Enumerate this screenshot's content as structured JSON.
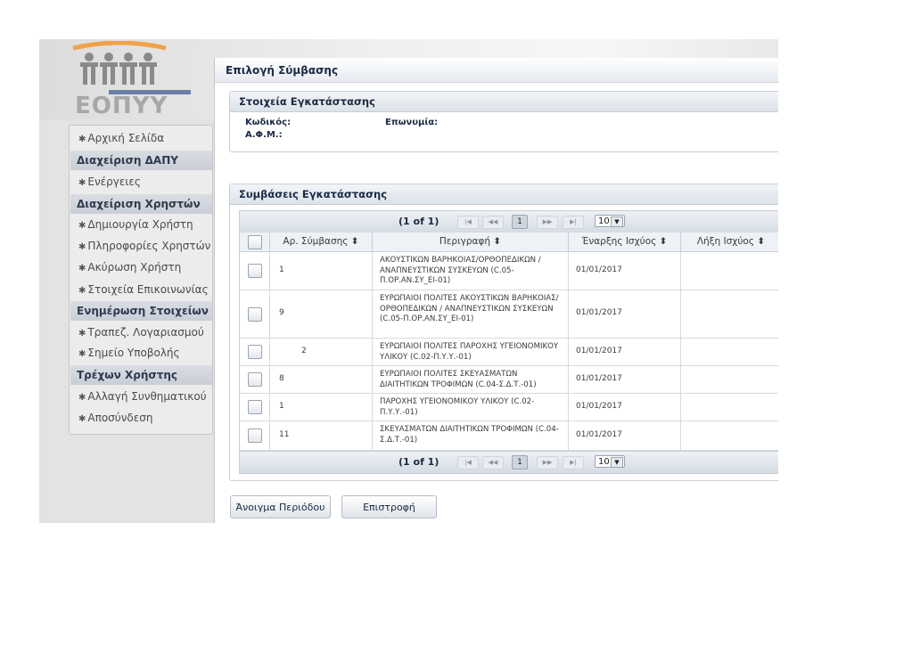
{
  "brand": {
    "logo_text": "ΕΟΠΥΥ"
  },
  "sidebar": {
    "items": [
      {
        "type": "link",
        "label": "Αρχική Σελίδα"
      },
      {
        "type": "header",
        "label": "Διαχείριση ΔΑΠΥ"
      },
      {
        "type": "link",
        "label": "Ενέργειες"
      },
      {
        "type": "header",
        "label": "Διαχείριση Χρηστών"
      },
      {
        "type": "link",
        "label": "Δημιουργία Χρήστη"
      },
      {
        "type": "link",
        "label": "Πληροφορίες Χρηστών"
      },
      {
        "type": "link",
        "label": "Ακύρωση Χρήστη"
      },
      {
        "type": "link",
        "label": "Στοιχεία Επικοινωνίας"
      },
      {
        "type": "header",
        "label": "Ενημέρωση Στοιχείων"
      },
      {
        "type": "link",
        "label": "Τραπεζ. Λογαριασμού"
      },
      {
        "type": "link",
        "label": "Σημείο Υποβολής"
      },
      {
        "type": "header",
        "label": "Τρέχων Χρήστης"
      },
      {
        "type": "link",
        "label": "Αλλαγή Συνθηματικού"
      },
      {
        "type": "link",
        "label": "Αποσύνδεση"
      }
    ]
  },
  "dialog": {
    "title": "Επιλογή Σύμβασης",
    "install_panel": {
      "title": "Στοιχεία Εγκατάστασης",
      "code_label": "Κωδικός:",
      "name_label": "Επωνυμία:",
      "afm_label": "Α.Φ.Μ.:"
    },
    "contracts_panel": {
      "title": "Συμβάσεις Εγκατάστασης",
      "pager": {
        "count": "(1 of 1)",
        "page": "1",
        "rows_per_page": "10"
      },
      "columns": [
        "Αρ. Σύμβασης",
        "Περιγραφή",
        "Έναρξης Ισχύος",
        "Λήξη Ισχύος"
      ],
      "sort_icon": "sort-both-icon",
      "rows": [
        {
          "number": "1",
          "description": "ΑΚΟΥΣΤΙΚΩΝ ΒΑΡΗΚΟΙΑΣ/ΟΡΘΟΠΕΔΙΚΩΝ / ΑΝΑΠΝΕΥΣΤΙΚΩΝ ΣΥΣΚΕΥΩΝ (C.05-Π.ΟΡ.ΑΝ.ΣΥ_ΕΙ-01)",
          "start": "01/01/2017",
          "end": ""
        },
        {
          "number": "9",
          "description": "ΕΥΡΩΠΑΙΟΙ ΠΟΛΙΤΕΣ ΑΚΟΥΣΤΙΚΩΝ ΒΑΡΗΚΟΙΑΣ/ΟΡΘΟΠΕΔΙΚΩΝ / ΑΝΑΠΝΕΥΣΤΙΚΩΝ ΣΥΣΚΕΥΩΝ (C.05-Π.ΟΡ.ΑΝ.ΣΥ_ΕΙ-01)",
          "start": "01/01/2017",
          "end": ""
        },
        {
          "number": "2",
          "description": "ΕΥΡΩΠΑΙΟΙ ΠΟΛΙΤΕΣ ΠΑΡΟΧΗΣ ΥΓΕΙΟΝΟΜΙΚΟΥ ΥΛΙΚΟΥ (C.02-Π.Υ.Υ.-01)",
          "start": "01/01/2017",
          "end": ""
        },
        {
          "number": "8",
          "description": "ΕΥΡΩΠΑΙΟΙ ΠΟΛΙΤΕΣ ΣΚΕΥΑΣΜΑΤΩΝ ΔΙΑΙΤΗΤΙΚΩΝ ΤΡΟΦΙΜΩΝ (C.04-Σ.Δ.Τ.-01)",
          "start": "01/01/2017",
          "end": ""
        },
        {
          "number": "1",
          "description": "ΠΑΡΟΧΗΣ ΥΓΕΙΟΝΟΜΙΚΟΥ ΥΛΙΚΟΥ (C.02-Π.Υ.Υ.-01)",
          "start": "01/01/2017",
          "end": ""
        },
        {
          "number": "11",
          "description": "ΣΚΕΥΑΣΜΑΤΩΝ ΔΙΑΙΤΗΤΙΚΩΝ ΤΡΟΦΙΜΩΝ (C.04-Σ.Δ.Τ.-01)",
          "start": "01/01/2017",
          "end": ""
        }
      ]
    },
    "buttons": {
      "open_period": "Άνοιγμα Περιόδου",
      "back": "Επιστροφή"
    }
  }
}
